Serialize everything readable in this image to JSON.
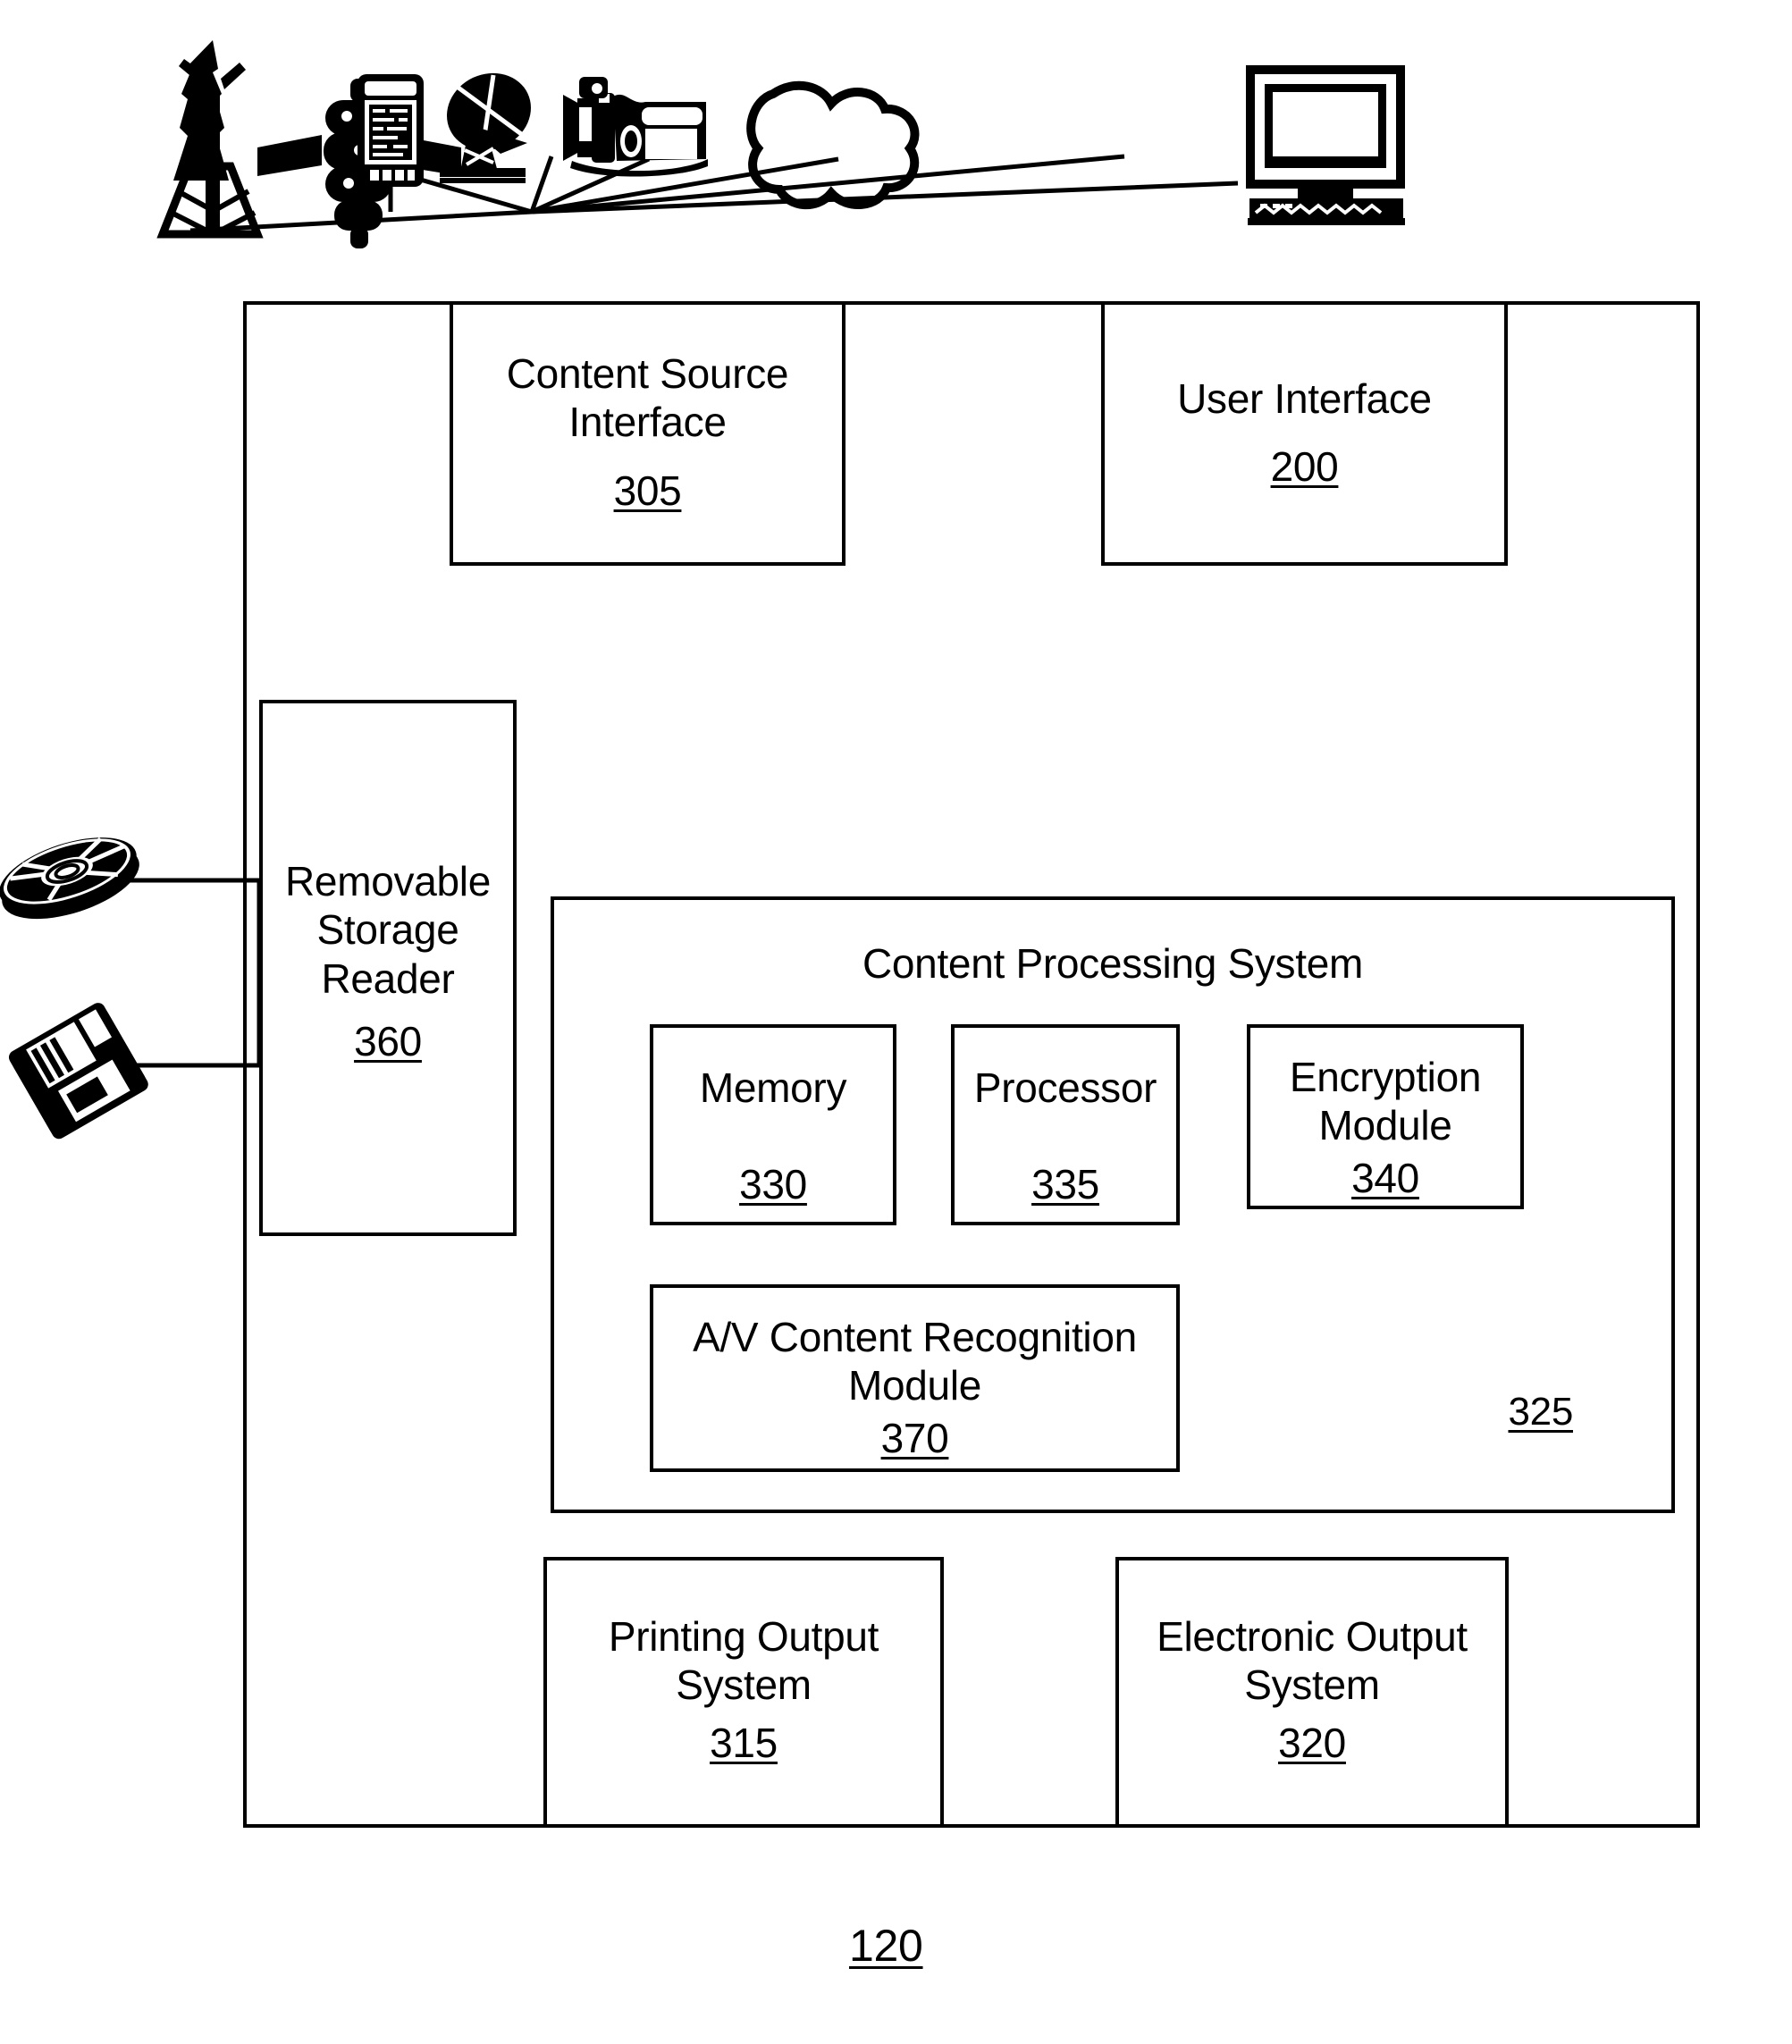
{
  "figure": {
    "reference_numeral": "120",
    "outer_box_name": "content-management-device"
  },
  "content_sources": [
    {
      "name": "broadcast-tower-icon",
      "label": "broadcast tower"
    },
    {
      "name": "satellite-icon",
      "label": "satellite"
    },
    {
      "name": "mobile-device-icon",
      "label": "mobile device"
    },
    {
      "name": "satellite-dish-icon",
      "label": "satellite dish"
    },
    {
      "name": "video-camera-icon",
      "label": "video camera"
    },
    {
      "name": "network-cloud-icon",
      "label": "network cloud"
    },
    {
      "name": "desktop-computer-icon",
      "label": "desktop computer"
    }
  ],
  "removable_media": [
    {
      "name": "optical-disc-icon",
      "label": "optical disc"
    },
    {
      "name": "floppy-disk-icon",
      "label": "floppy disk"
    }
  ],
  "blocks": {
    "content_source_interface": {
      "title_line1": "Content Source",
      "title_line2": "Interface",
      "ref": "305"
    },
    "user_interface": {
      "title_line1": "User Interface",
      "ref": "200"
    },
    "removable_storage_reader": {
      "title_line1": "Removable",
      "title_line2": "Storage",
      "title_line3": "Reader",
      "ref": "360"
    },
    "content_processing_system": {
      "title_line1": "Content Processing System",
      "ref": "325"
    },
    "memory": {
      "title_line1": "Memory",
      "ref": "330"
    },
    "processor": {
      "title_line1": "Processor",
      "ref": "335"
    },
    "encryption_module": {
      "title_line1": "Encryption",
      "title_line2": "Module",
      "ref": "340"
    },
    "av_content_recognition_module": {
      "title_line1": "A/V Content Recognition",
      "title_line2": "Module",
      "ref": "370"
    },
    "printing_output_system": {
      "title_line1": "Printing Output",
      "title_line2": "System",
      "ref": "315"
    },
    "electronic_output_system": {
      "title_line1": "Electronic Output",
      "title_line2": "System",
      "ref": "320"
    }
  },
  "colors": {
    "stroke": "#000000",
    "background": "#ffffff"
  }
}
